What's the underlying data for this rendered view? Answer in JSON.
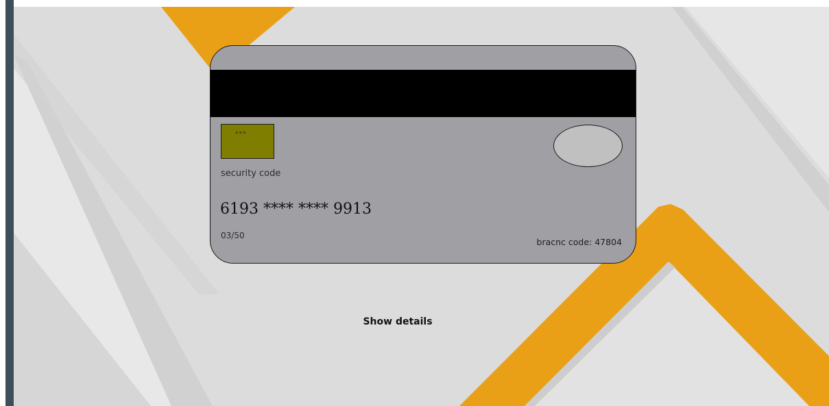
{
  "card": {
    "security_code_value": "***",
    "security_code_label": "security code",
    "number": "6193 **** **** 9913",
    "expiry": "03/50",
    "branch_code": "bracnc code: 47804"
  },
  "actions": {
    "show_details_label": "Show details"
  },
  "colors": {
    "accent_orange": "#e9a017",
    "card_gray": "#a09fa4",
    "stripe": "#000000",
    "security_box": "#7f7e00",
    "sidebar": "#3f4f59",
    "background": "#dcdcdc"
  }
}
